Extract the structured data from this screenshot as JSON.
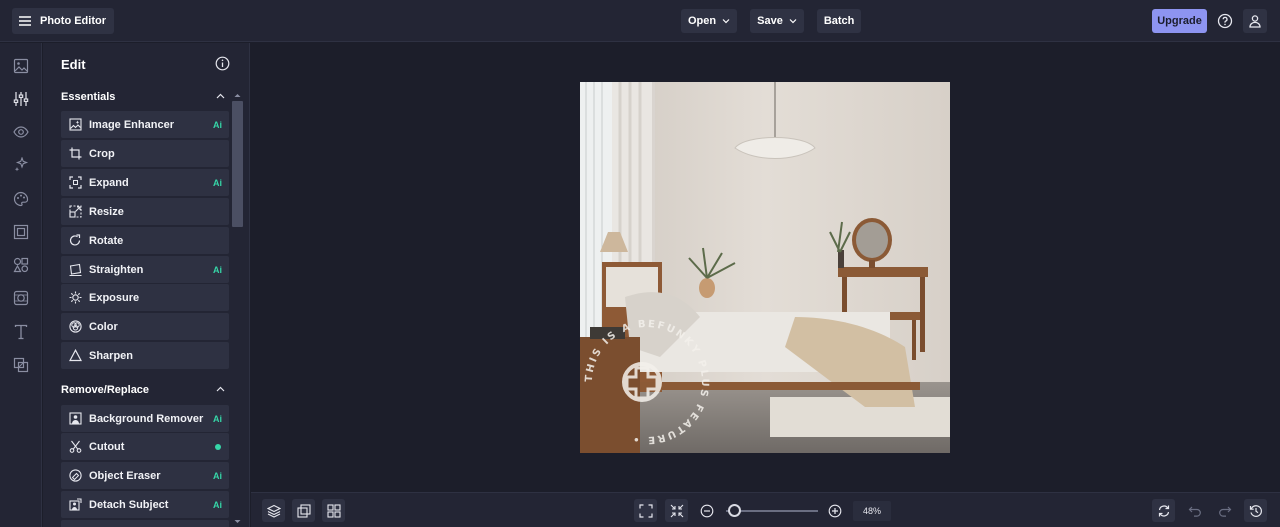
{
  "app": {
    "title": "Photo Editor",
    "menu_icon": "hamburger-icon"
  },
  "top_menu": {
    "open": "Open",
    "save": "Save",
    "batch": "Batch",
    "upgrade": "Upgrade"
  },
  "rail": {
    "items": [
      "image-icon",
      "sliders-icon",
      "eye-icon",
      "sparkle-icon",
      "palette-icon",
      "frame-icon",
      "graphics-icon",
      "texture-icon",
      "text-icon",
      "overlay-icon"
    ],
    "active": "sliders-icon"
  },
  "panel": {
    "title": "Edit",
    "sections": [
      {
        "title": "Essentials",
        "tools": [
          {
            "label": "Image Enhancer",
            "icon": "image-enhance-icon",
            "badge": "Ai"
          },
          {
            "label": "Crop",
            "icon": "crop-icon",
            "badge": ""
          },
          {
            "label": "Expand",
            "icon": "expand-icon",
            "badge": "Ai"
          },
          {
            "label": "Resize",
            "icon": "resize-icon",
            "badge": ""
          },
          {
            "label": "Rotate",
            "icon": "rotate-icon",
            "badge": ""
          },
          {
            "label": "Straighten",
            "icon": "straighten-icon",
            "badge": "Ai"
          },
          {
            "label": "Exposure",
            "icon": "exposure-icon",
            "badge": ""
          },
          {
            "label": "Color",
            "icon": "color-icon",
            "badge": ""
          },
          {
            "label": "Sharpen",
            "icon": "sharpen-icon",
            "badge": ""
          }
        ]
      },
      {
        "title": "Remove/Replace",
        "tools": [
          {
            "label": "Background Remover",
            "icon": "background-remover-icon",
            "badge": "Ai"
          },
          {
            "label": "Cutout",
            "icon": "scissors-icon",
            "badge": "dot"
          },
          {
            "label": "Object Eraser",
            "icon": "object-eraser-icon",
            "badge": "Ai"
          },
          {
            "label": "Detach Subject",
            "icon": "detach-subject-icon",
            "badge": "Ai"
          }
        ]
      }
    ]
  },
  "canvas": {
    "watermark_text": "THIS IS A BEFUNKY PLUS FEATURE •"
  },
  "bottom": {
    "zoom": "48%",
    "zoom_fraction": 0.03
  },
  "colors": {
    "accent": "#8d94f0",
    "ai_badge": "#36d6a8",
    "background": "#1c1e2a",
    "panel": "#232534"
  }
}
